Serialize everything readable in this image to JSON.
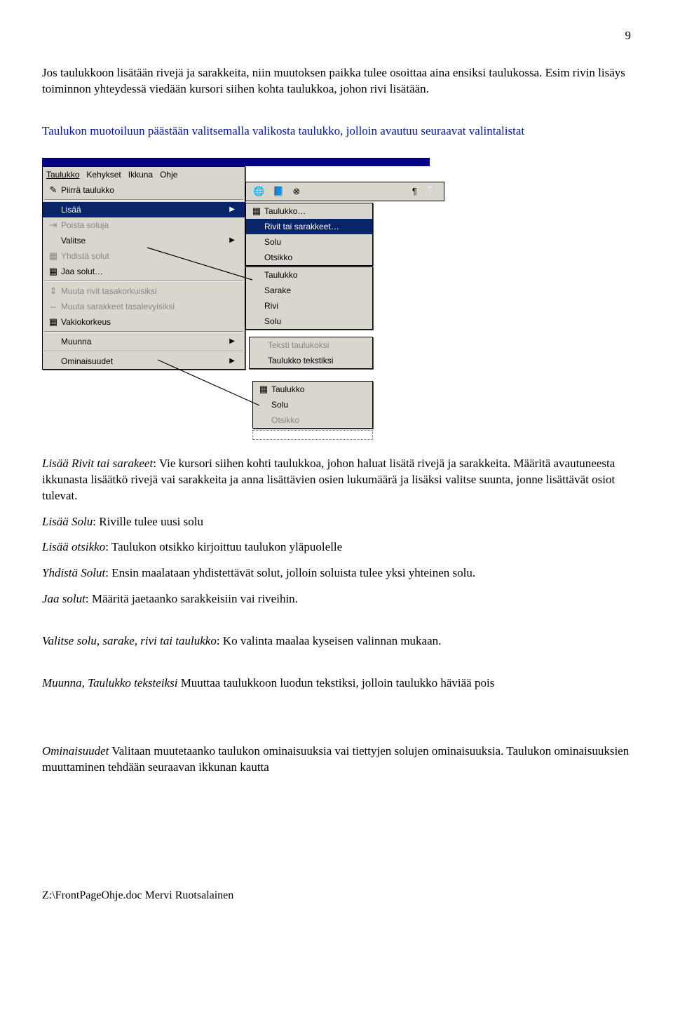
{
  "page_number": "9",
  "para1": "Jos taulukkoon lisätään rivejä ja sarakkeita, niin muutoksen paikka tulee osoittaa aina ensiksi taulukossa. Esim rivin lisäys toiminnon yhteydessä viedään kursori siihen kohta taulukkoa, johon rivi lisätään.",
  "para2": "Taulukon muotoiluun päästään valitsemalla valikosta taulukko, jolloin avautuu seuraavat valintalistat",
  "menubar": {
    "items": [
      "Taulukko",
      "Kehykset",
      "Ikkuna",
      "Ohje"
    ]
  },
  "toolbar_icons": [
    "🌐",
    "📘",
    "⊗",
    "¶",
    "❔"
  ],
  "primary_menu": {
    "items": [
      {
        "icon": "✎",
        "label": "Piirrä taulukko"
      },
      {
        "label": "Lisää",
        "selected": true,
        "hasSub": true
      },
      {
        "icon": "⇥",
        "label": "Poista soluja",
        "disabled": true
      },
      {
        "label": "Valitse",
        "hasSub": true
      },
      {
        "icon": "▦",
        "label": "Yhdistä solut",
        "disabled": true
      },
      {
        "icon": "▦",
        "label": "Jaa solut…"
      },
      {
        "icon": "⇕",
        "label": "Muuta rivit tasakorkuisiksi",
        "disabled": true
      },
      {
        "icon": "⇔",
        "label": "Muuta sarakkeet tasalevyisiksi",
        "disabled": true
      },
      {
        "icon": "▦",
        "label": "Vakiokorkeus"
      },
      {
        "label": "Muunna",
        "hasSub": true
      },
      {
        "label": "Ominaisuudet",
        "hasSub": true
      }
    ]
  },
  "submenu_insert": {
    "items": [
      {
        "icon": "▦",
        "label": "Taulukko…"
      },
      {
        "label": "Rivit tai sarakkeet…",
        "selected": true
      },
      {
        "label": "Solu"
      },
      {
        "label": "Otsikko"
      }
    ]
  },
  "submenu_select": {
    "items": [
      {
        "label": "Taulukko"
      },
      {
        "label": "Sarake"
      },
      {
        "label": "Rivi"
      },
      {
        "label": "Solu"
      }
    ]
  },
  "submenu_convert": {
    "items": [
      {
        "label": "Teksti taulukoksi",
        "disabled": true
      },
      {
        "label": "Taulukko tekstiksi"
      }
    ]
  },
  "submenu_props": {
    "items": [
      {
        "icon": "▦",
        "label": "Taulukko"
      },
      {
        "label": "Solu"
      },
      {
        "label": "Otsikko",
        "disabled": true
      }
    ]
  },
  "bullets": {
    "b1t": "Lisää Rivit tai sarakeet",
    "b1": ": Vie kursori siihen kohti taulukkoa, johon haluat lisätä rivejä ja sarakkeita. Määritä avautuneesta ikkunasta lisäätkö rivejä vai sarakkeita ja anna lisättävien osien lukumäärä ja lisäksi valitse suunta, jonne lisättävät osiot tulevat.",
    "b2t": "Lisää Solu",
    "b2": ": Riville tulee uusi solu",
    "b3t": "Lisää otsikko",
    "b3": ": Taulukon otsikko kirjoittuu taulukon yläpuolelle",
    "b4t": "Yhdistä Solut",
    "b4": ": Ensin maalataan yhdistettävät solut, jolloin soluista tulee yksi yhteinen solu.",
    "b5t": "Jaa solut",
    "b5": ": Määritä jaetaanko sarakkeisiin vai riveihin.",
    "b6t": "Valitse solu, sarake, rivi tai taulukko",
    "b6": ": Ko valinta maalaa kyseisen valinnan mukaan.",
    "b7t": "Muunna, Taulukko teksteiksi",
    "b7": " Muuttaa taulukkoon luodun tekstiksi, jolloin taulukko häviää pois",
    "b8t": "Ominaisuudet",
    "b8": " Valitaan muutetaanko taulukon ominaisuuksia vai tiettyjen solujen ominaisuuksia. Taulukon ominaisuuksien muuttaminen tehdään seuraavan ikkunan kautta"
  },
  "footer": "Z:\\FrontPageOhje.doc Mervi Ruotsalainen"
}
